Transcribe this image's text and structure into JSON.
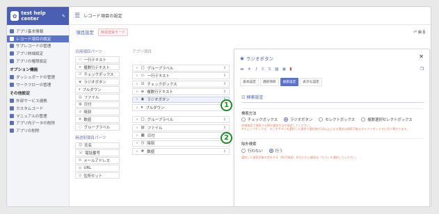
{
  "brand": {
    "name": "test help center"
  },
  "topbar": {
    "title": "レコード項目の設定"
  },
  "sidebar": {
    "items_top": [
      "アプリ基本情報",
      "レコード項目の設定",
      "サブレコードの管理",
      "アプリ詳細設定",
      "アプリの権限設定"
    ],
    "section_options": "オプション機能",
    "items_options": [
      "ダッシュボードの管理",
      "ワークフローの管理"
    ],
    "section_other": "その他設定",
    "items_other": [
      "外部サービス連携",
      "カスタムコード",
      "マニュアルの管理",
      "アプリ内データの削除",
      "アプリの削除"
    ]
  },
  "header": {
    "title": "項目設定",
    "badge": "簡易登録モード",
    "back": "戻る"
  },
  "parts": {
    "general_title": "汎用項目パーツ",
    "general": [
      "一行テキスト",
      "複数行テキスト",
      "チェックボックス",
      "ラジオボタン",
      "プルダウン",
      "ファイル",
      "日付",
      "時刻",
      "数値",
      "グループラベル"
    ],
    "special_title": "用途別項目パーツ",
    "special": [
      "氏名",
      "電話番号",
      "メールアドレス",
      "URL",
      "住所セット"
    ]
  },
  "app_items": {
    "title": "アプリ項目",
    "group1": [
      "グループラベル",
      "一行テキスト",
      "チェックボックス",
      "複数行テキスト",
      "ラジオボタン",
      "プルダウン"
    ],
    "group2": [
      "グループラベル",
      "ファイル",
      "日付",
      "時刻",
      "数値"
    ]
  },
  "panel": {
    "title": "ラジオボタン",
    "tabs": [
      "基本設定",
      "選択項目",
      "検索設定",
      "表示な設定"
    ],
    "section_title": "検索設定",
    "method_label": "検索方法",
    "method_options": [
      "チェックボックス",
      "ラジオボタン",
      "セレクトボックス",
      "複数選択セレクトボックス"
    ],
    "method_selected": 1,
    "method_note_1": "詳細検索で検索する際の選択方法を指定してください。",
    "method_note_2": "※チェックボックス、ラジオボタンを選択した場合で選択肢が10以上になる場合は検索可能なセレクトボックスに切り替わります。",
    "exclude_label": "除外検索",
    "exclude_options": [
      "行わない",
      "行う"
    ],
    "exclude_selected": 1,
    "exclude_note": "選択した検索対象を除外する（NOT検索）を行いたい場合は「行う」を選択してください。",
    "markers": [
      "1",
      "2"
    ]
  }
}
